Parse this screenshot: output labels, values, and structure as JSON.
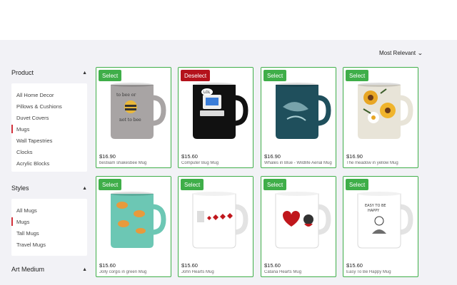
{
  "sort": {
    "label": "Most Relevant"
  },
  "facets": {
    "product": {
      "title": "Product",
      "items": [
        {
          "label": "All Home Decor",
          "active": false
        },
        {
          "label": "Pillows & Cushions",
          "active": false
        },
        {
          "label": "Duvet Covers",
          "active": false
        },
        {
          "label": "Mugs",
          "active": true
        },
        {
          "label": "Wall Tapestries",
          "active": false
        },
        {
          "label": "Clocks",
          "active": false
        },
        {
          "label": "Acrylic Blocks",
          "active": false
        }
      ]
    },
    "styles": {
      "title": "Styles",
      "items": [
        {
          "label": "All Mugs",
          "active": false
        },
        {
          "label": "Mugs",
          "active": true
        },
        {
          "label": "Tall Mugs",
          "active": false
        },
        {
          "label": "Travel Mugs",
          "active": false
        }
      ]
    },
    "art_medium": {
      "title": "Art Medium"
    }
  },
  "products": [
    {
      "badge": "Select",
      "selected": false,
      "price": "$16.90",
      "title": "bestiiam shakesbee Mug",
      "mug_color": "#a8a4a4",
      "art": "bee"
    },
    {
      "badge": "Deselect",
      "selected": true,
      "price": "$15.60",
      "title": "Computer Bug Mug",
      "mug_color": "#111111",
      "art": "computer"
    },
    {
      "badge": "Select",
      "selected": false,
      "price": "$16.90",
      "title": "Whales in Blue - Wildlife Aerial Mug",
      "mug_color": "#1f4f5c",
      "art": "whale"
    },
    {
      "badge": "Select",
      "selected": false,
      "price": "$16.90",
      "title": "The meadow in yellow Mug",
      "mug_color": "#e8e4d8",
      "art": "flowers"
    },
    {
      "badge": "Select",
      "selected": false,
      "price": "$15.60",
      "title": "Jolly corgis in green Mug",
      "mug_color": "#6cc7b4",
      "art": "corgi"
    },
    {
      "badge": "Select",
      "selected": false,
      "price": "$15.60",
      "title": "John Hearts Mug",
      "mug_color": "#ffffff",
      "art": "hearts-line"
    },
    {
      "badge": "Select",
      "selected": false,
      "price": "$15.60",
      "title": "Catana Hearts Mug",
      "mug_color": "#ffffff",
      "art": "hearts-big"
    },
    {
      "badge": "Select",
      "selected": false,
      "price": "$15.60",
      "title": "Easy To Be Happy Mug",
      "mug_color": "#ffffff",
      "art": "sketch"
    }
  ]
}
